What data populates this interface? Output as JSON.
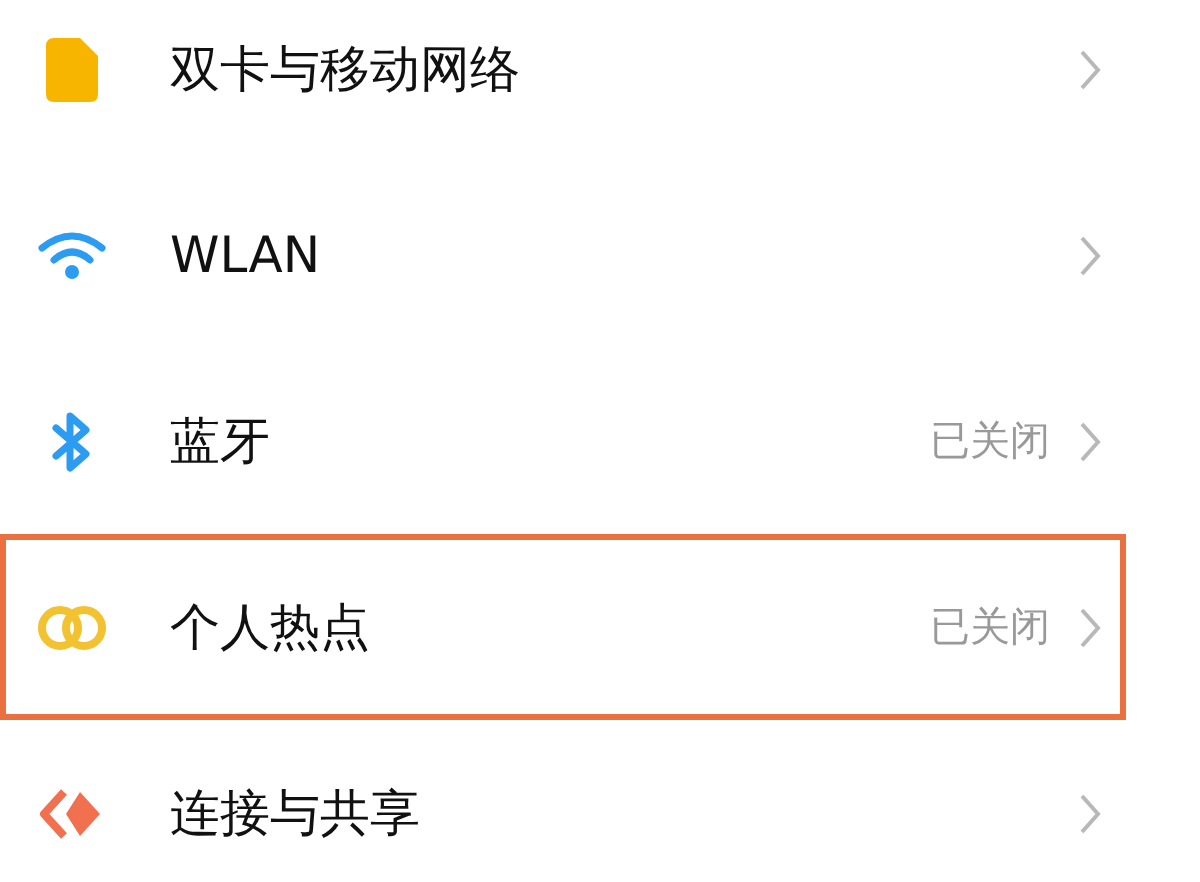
{
  "settings": [
    {
      "kind": "sim",
      "label": "双卡与移动网络",
      "highlighted": false
    },
    {
      "kind": "wifi",
      "label": "WLAN",
      "highlighted": false
    },
    {
      "kind": "bluetooth",
      "label": "蓝牙",
      "status": "已关闭",
      "highlighted": false
    },
    {
      "kind": "hotspot",
      "label": "个人热点",
      "status": "已关闭",
      "highlighted": true
    },
    {
      "kind": "share",
      "label": "连接与共享",
      "highlighted": false
    }
  ]
}
